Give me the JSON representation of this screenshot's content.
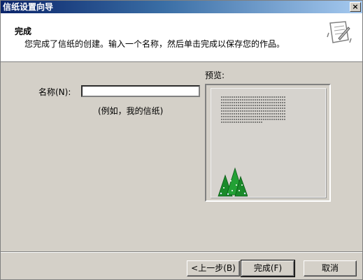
{
  "window": {
    "title": "信纸设置向导",
    "close_glyph": "×"
  },
  "header": {
    "title": "完成",
    "description": "您完成了信纸的创建。输入一个名称，然后单击完成以保存您的作品。",
    "icon": "stationery-wizard-icon"
  },
  "form": {
    "name_label": "名称(N):",
    "name_value": "",
    "example": "(例如，我的信纸)"
  },
  "preview": {
    "label": "预览:",
    "decoration": "christmas-tree-icon"
  },
  "buttons": {
    "back": "<上一步(B)",
    "finish": "完成(F)",
    "cancel": "取消"
  },
  "colors": {
    "titlebar_start": "#0a246a",
    "titlebar_end": "#a6caf0",
    "face": "#d4d0c8",
    "tree": "#1a8a2a"
  }
}
